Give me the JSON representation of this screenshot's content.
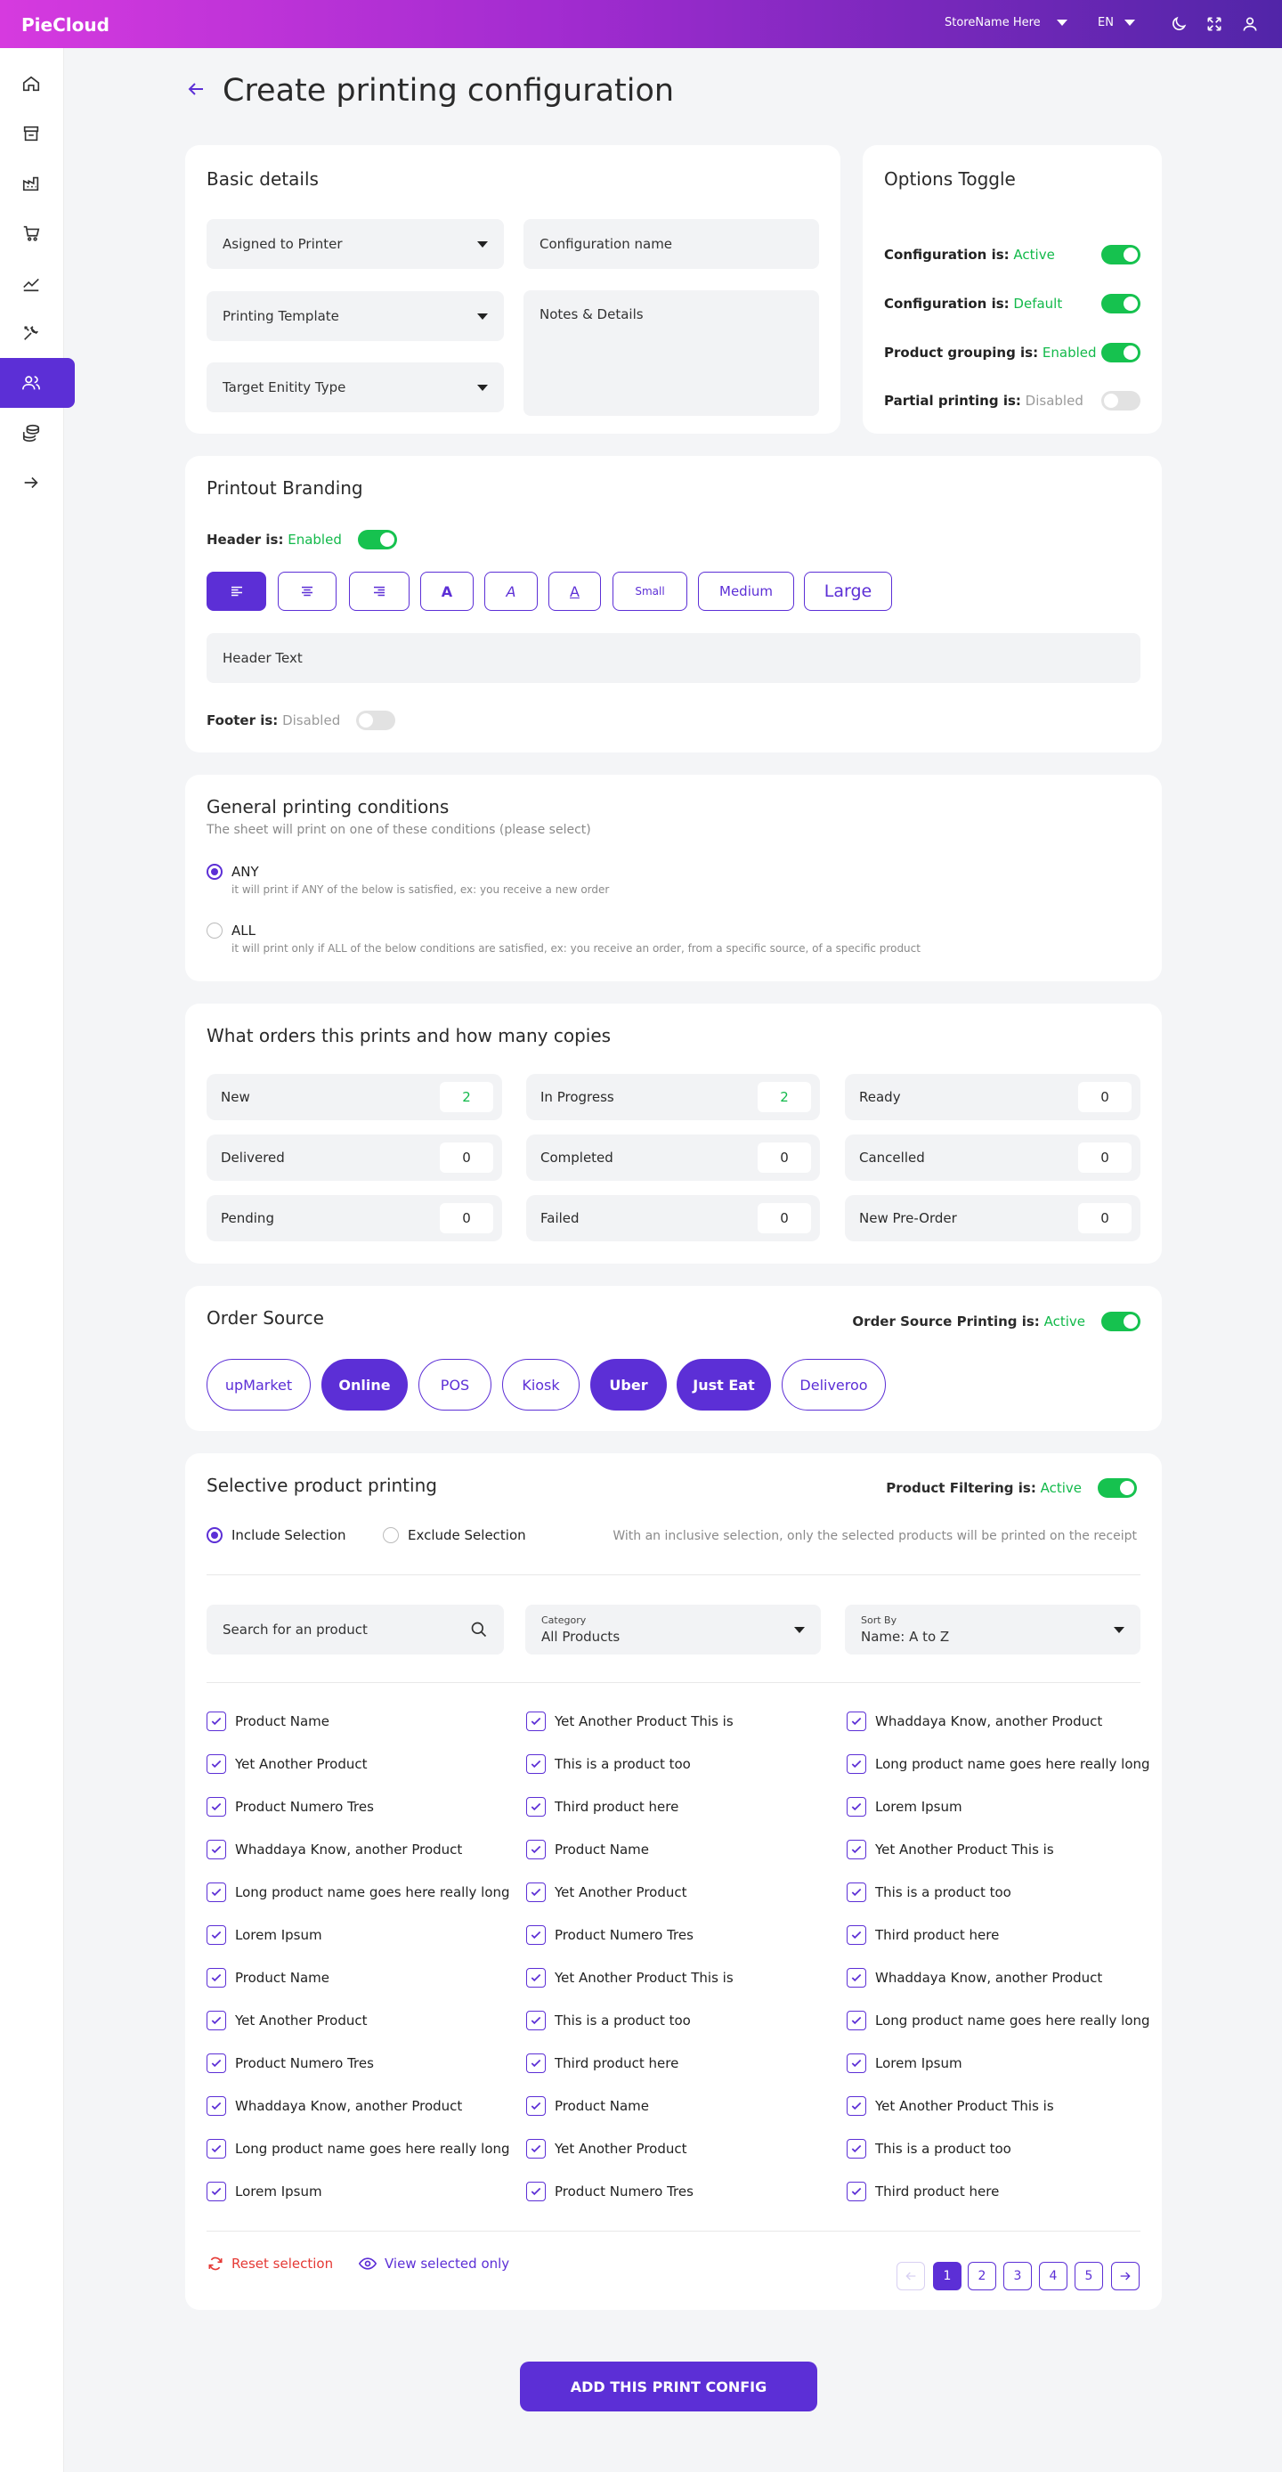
{
  "brand": "PieCloud",
  "topbar": {
    "store": "StoreName Here",
    "lang": "EN"
  },
  "page_title": "Create printing configuration",
  "basic": {
    "title": "Basic details",
    "printer": "Asigned to Printer",
    "template": "Printing Template",
    "entity": "Target Enitity Type",
    "config_name": "Configuration name",
    "notes": "Notes & Details"
  },
  "options": {
    "title": "Options Toggle",
    "items": [
      {
        "label": "Configuration is:",
        "status": "Active",
        "on": true
      },
      {
        "label": "Configuration is:",
        "status": "Default",
        "on": true
      },
      {
        "label": "Product grouping is:",
        "status": "Enabled",
        "on": true
      },
      {
        "label": "Partial printing is:",
        "status": "Disabled",
        "on": false
      }
    ]
  },
  "branding": {
    "title": "Printout Branding",
    "header_label": "Header is:",
    "header_status": "Enabled",
    "header_text": "Header Text",
    "footer_label": "Footer is:",
    "footer_status": "Disabled",
    "fmt": {
      "a": "A",
      "small": "Small",
      "medium": "Medium",
      "large": "Large"
    }
  },
  "conditions": {
    "title": "General printing conditions",
    "subtitle": "The sheet will print on one of these conditions (please select)",
    "any": "ANY",
    "any_desc": "it will print if ANY of the below is satisfied, ex: you receive a new order",
    "all": "ALL",
    "all_desc": "it will print only if ALL of the below conditions are satisfied, ex: you receive an order, from a specific source, of a specific product"
  },
  "orders": {
    "title": "What orders this prints and how many copies",
    "items": [
      {
        "label": "New",
        "value": "2"
      },
      {
        "label": "In Progress",
        "value": "2"
      },
      {
        "label": "Ready",
        "value": "0"
      },
      {
        "label": "Delivered",
        "value": "0"
      },
      {
        "label": "Completed",
        "value": "0"
      },
      {
        "label": "Cancelled",
        "value": "0"
      },
      {
        "label": "Pending",
        "value": "0"
      },
      {
        "label": "Failed",
        "value": "0"
      },
      {
        "label": "New Pre-Order",
        "value": "0"
      }
    ]
  },
  "source": {
    "title": "Order Source",
    "toggle_label": "Order Source Printing is:",
    "toggle_status": "Active",
    "items": [
      {
        "label": "upMarket",
        "sel": false
      },
      {
        "label": "Online",
        "sel": true
      },
      {
        "label": "POS",
        "sel": false
      },
      {
        "label": "Kiosk",
        "sel": false
      },
      {
        "label": "Uber",
        "sel": true
      },
      {
        "label": "Just Eat",
        "sel": true
      },
      {
        "label": "Deliveroo",
        "sel": false
      }
    ]
  },
  "selective": {
    "title": "Selective product printing",
    "toggle_label": "Product Filtering is:",
    "toggle_status": "Active",
    "include": "Include Selection",
    "exclude": "Exclude Selection",
    "hint": "With an inclusive selection, only the selected products will be printed on the receipt",
    "search_placeholder": "Search for an product",
    "category_label": "Category",
    "category_value": "All Products",
    "sort_label": "Sort By",
    "sort_value": "Name: A to Z",
    "products": [
      "Product Name",
      "Yet Another Product This is",
      "Whaddaya Know, another Product",
      "Yet Another Product",
      "This is a product too",
      "Long product name goes here really long",
      "Product Numero Tres",
      "Third product here",
      "Lorem Ipsum",
      "Whaddaya Know, another Product",
      "Product Name",
      "Yet Another Product This is",
      "Long product name goes here really long",
      "Yet Another Product",
      "This is a product too",
      "Lorem Ipsum",
      "Product Numero Tres",
      "Third product here",
      "Product Name",
      "Yet Another Product This is",
      "Whaddaya Know, another Product",
      "Yet Another Product",
      "This is a product too",
      "Long product name goes here really long",
      "Product Numero Tres",
      "Third product here",
      "Lorem Ipsum",
      "Whaddaya Know, another Product",
      "Product Name",
      "Yet Another Product This is",
      "Long product name goes here really long",
      "Yet Another Product",
      "This is a product too",
      "Lorem Ipsum",
      "Product Numero Tres",
      "Third product here"
    ],
    "reset": "Reset selection",
    "view_selected": "View selected only",
    "pages": [
      "1",
      "2",
      "3",
      "4",
      "5"
    ]
  },
  "submit": "ADD THIS PRINT CONFIG",
  "colors": {
    "accent": "#5c2fd6",
    "active": "#12b94a",
    "reset": "#e53935"
  }
}
